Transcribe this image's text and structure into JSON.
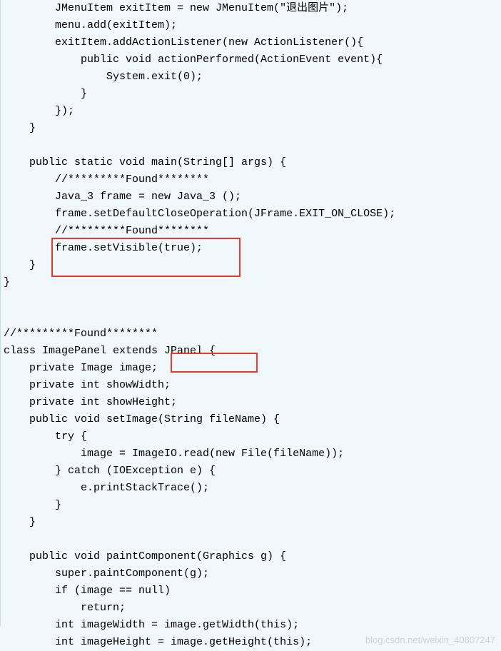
{
  "code": {
    "lines": [
      "        JMenuItem exitItem = new JMenuItem(\"退出图片\");",
      "        menu.add(exitItem);",
      "        exitItem.addActionListener(new ActionListener(){",
      "            public void actionPerformed(ActionEvent event){",
      "                System.exit(0);",
      "            }",
      "        });",
      "    }",
      "",
      "    public static void main(String[] args) {",
      "        //*********Found********",
      "        Java_3 frame = new Java_3 ();",
      "        frame.setDefaultCloseOperation(JFrame.EXIT_ON_CLOSE);",
      "        //*********Found********",
      "        frame.setVisible(true);",
      "    }",
      "}",
      "",
      "",
      "//*********Found********",
      "class ImagePanel extends JPanel {",
      "    private Image image;",
      "    private int showWidth;",
      "    private int showHeight;",
      "    public void setImage(String fileName) {",
      "        try {",
      "            image = ImageIO.read(new File(fileName));",
      "        } catch (IOException e) {",
      "            e.printStackTrace();",
      "        }",
      "    }",
      "",
      "    public void paintComponent(Graphics g) {",
      "        super.paintComponent(g);",
      "        if (image == null)",
      "            return;",
      "        int imageWidth = image.getWidth(this);",
      "        int imageHeight = image.getHeight(this);"
    ]
  },
  "watermark": "blog.csdn.net/weixin_40807247"
}
